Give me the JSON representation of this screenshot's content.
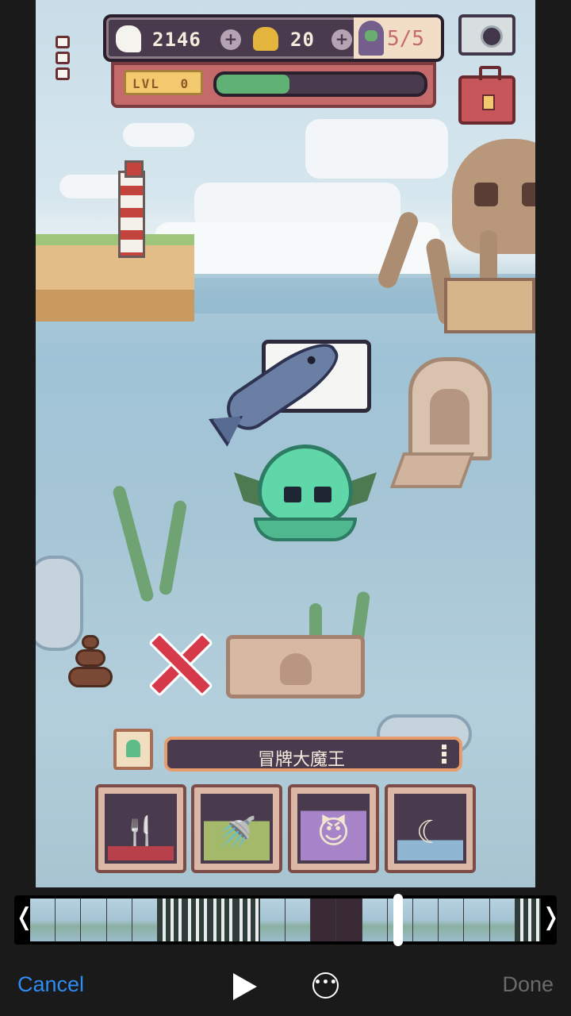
{
  "hud": {
    "souls": "2146",
    "skulls": "20",
    "cultists": "5/5",
    "level_label": "LVL",
    "level_value": "0",
    "xp_progress": 0.35,
    "plus_symbol": "+"
  },
  "pet": {
    "name": "冒牌大魔王",
    "thought_item": "fish"
  },
  "actions": [
    {
      "name": "feed",
      "icon": "fork-knife-icon",
      "glyph": "🍴"
    },
    {
      "name": "clean",
      "icon": "shower-icon",
      "glyph": "🚿"
    },
    {
      "name": "play",
      "icon": "devil-face-icon",
      "glyph": "😈"
    },
    {
      "name": "sleep",
      "icon": "moon-icon",
      "glyph": "☾"
    }
  ],
  "editor": {
    "cancel_label": "Cancel",
    "done_label": "Done",
    "more_label": "•••",
    "left_handle": "❬",
    "right_handle": "❭"
  },
  "colors": {
    "accent_blue": "#2f8cf2",
    "done_gray": "#6b6b6b",
    "hud_purple": "#4a3a4e",
    "pet_green": "#5fd7a8",
    "xp_green": "#5fb274"
  }
}
